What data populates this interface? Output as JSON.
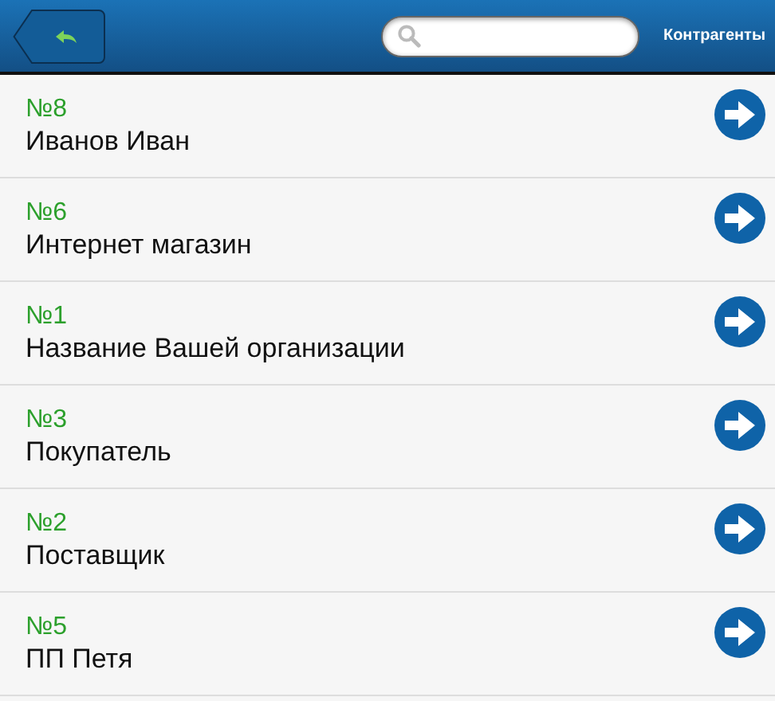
{
  "header": {
    "title": "Контрагенты"
  },
  "items": [
    {
      "number": "№8",
      "name": "Иванов Иван"
    },
    {
      "number": "№6",
      "name": "Интернет магазин"
    },
    {
      "number": "№1",
      "name": "Название Вашей организации"
    },
    {
      "number": "№3",
      "name": "Покупатель"
    },
    {
      "number": "№2",
      "name": "Поставщик"
    },
    {
      "number": "№5",
      "name": "ПП Петя"
    }
  ]
}
